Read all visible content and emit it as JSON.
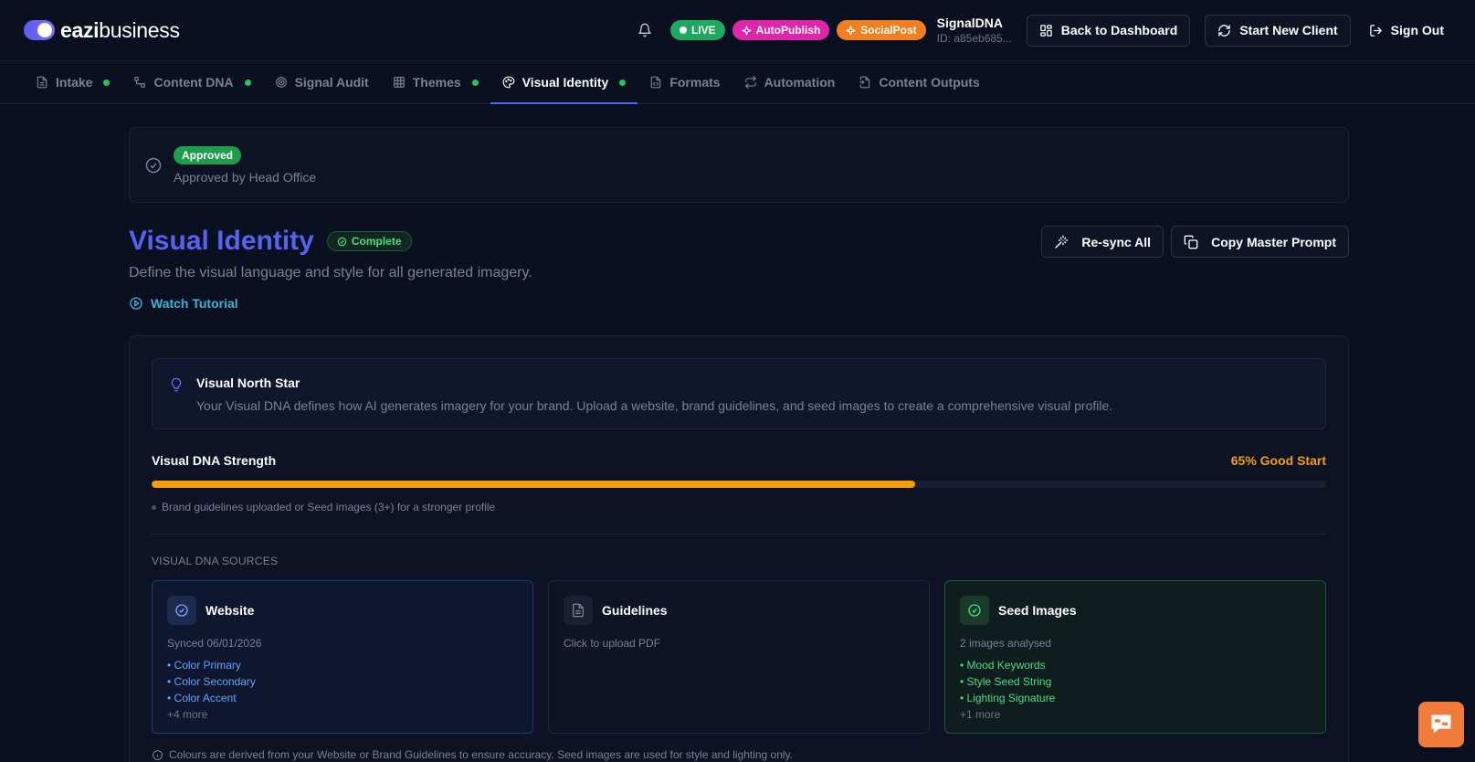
{
  "brand": {
    "bold": "eazi",
    "light": "business"
  },
  "header": {
    "badges": {
      "live": "LIVE",
      "autopublish": "AutoPublish",
      "socialpost": "SocialPost"
    },
    "account": {
      "name": "SignalDNA",
      "id": "ID: a85eb685..."
    },
    "back_label": "Back to Dashboard",
    "new_client_label": "Start New Client",
    "signout_label": "Sign Out"
  },
  "tabs": [
    {
      "label": "Intake",
      "icon": "file-text-icon",
      "complete": true
    },
    {
      "label": "Content DNA",
      "icon": "network-icon",
      "complete": true
    },
    {
      "label": "Signal Audit",
      "icon": "target-icon",
      "complete": false
    },
    {
      "label": "Themes",
      "icon": "grid-icon",
      "complete": true
    },
    {
      "label": "Visual Identity",
      "icon": "palette-icon",
      "complete": true,
      "active": true
    },
    {
      "label": "Formats",
      "icon": "file-format-icon",
      "complete": false
    },
    {
      "label": "Automation",
      "icon": "repeat-icon",
      "complete": false
    },
    {
      "label": "Content Outputs",
      "icon": "file-output-icon",
      "complete": false
    }
  ],
  "approval": {
    "badge": "Approved",
    "text": "Approved by Head Office"
  },
  "page": {
    "title": "Visual Identity",
    "status": "Complete",
    "subtitle": "Define the visual language and style for all generated imagery.",
    "watch_label": "Watch Tutorial",
    "resync_label": "Re-sync All",
    "copy_label": "Copy Master Prompt"
  },
  "north_star": {
    "title": "Visual North Star",
    "text": "Your Visual DNA defines how AI generates imagery for your brand. Upload a website, brand guidelines, and seed images to create a comprehensive visual profile."
  },
  "strength": {
    "label": "Visual DNA Strength",
    "value_text": "65% Good Start",
    "percent": 65,
    "hint": "Brand guidelines uploaded or Seed images (3+) for a stronger profile"
  },
  "sources": {
    "heading": "VISUAL DNA SOURCES",
    "website": {
      "title": "Website",
      "status": "Synced 06/01/2026",
      "items": [
        "• Color Primary",
        "• Color Secondary",
        "• Color Accent"
      ],
      "more": "+4 more"
    },
    "guidelines": {
      "title": "Guidelines",
      "status": "Click to upload PDF"
    },
    "seed": {
      "title": "Seed Images",
      "status": "2 images analysed",
      "items": [
        "• Mood Keywords",
        "• Style Seed String",
        "• Lighting Signature"
      ],
      "more": "+1 more"
    }
  },
  "footnote": "Colours are derived from your Website or Brand Guidelines to ensure accuracy. Seed images are used for style and lighting only.",
  "colors": {
    "accent": "#5563f5",
    "success": "#22c55e",
    "warning": "#f59e0b",
    "live": "#1fa85f",
    "autopublish": "#e026a8",
    "socialpost": "#f07f1f"
  }
}
